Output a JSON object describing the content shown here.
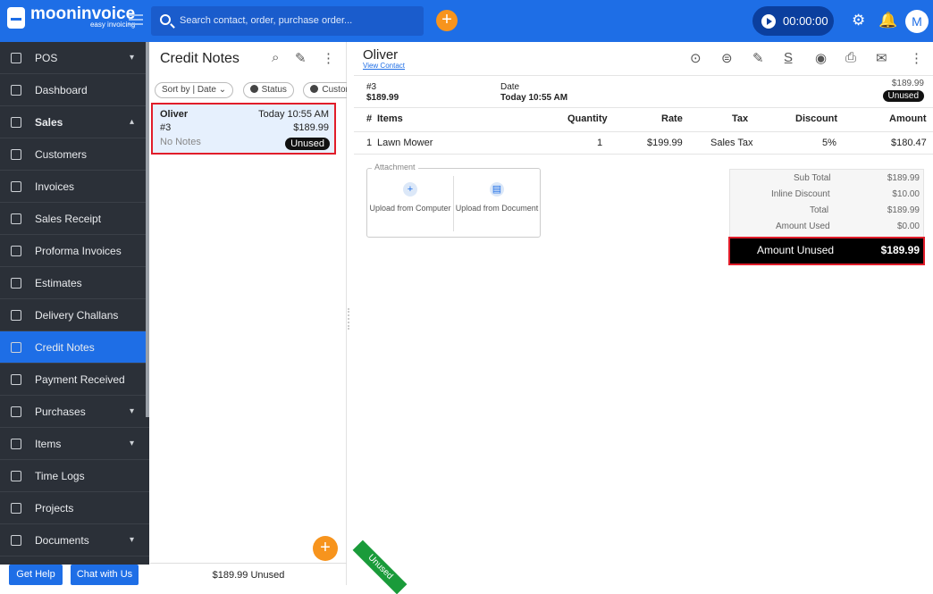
{
  "brand": {
    "name": "mooninvoice",
    "tagline": "easy invoicing"
  },
  "header": {
    "search_placeholder": "Search contact, order, purchase order...",
    "timer": "00:00:00",
    "avatar": "M"
  },
  "sidebar": {
    "items": [
      {
        "label": "POS",
        "icon": "pos-icon",
        "chevron": "▾"
      },
      {
        "label": "Dashboard",
        "icon": "home-icon"
      },
      {
        "label": "Sales",
        "icon": "dollar-icon",
        "chevron": "▴"
      },
      {
        "label": "Customers",
        "icon": "contacts-icon"
      },
      {
        "label": "Invoices",
        "icon": "invoice-icon"
      },
      {
        "label": "Sales Receipt",
        "icon": "receipt-icon"
      },
      {
        "label": "Proforma Invoices",
        "icon": "proforma-icon"
      },
      {
        "label": "Estimates",
        "icon": "estimates-icon"
      },
      {
        "label": "Delivery Challans",
        "icon": "delivery-icon"
      },
      {
        "label": "Credit Notes",
        "icon": "credit-notes-icon"
      },
      {
        "label": "Payment Received",
        "icon": "payment-icon"
      },
      {
        "label": "Purchases",
        "icon": "purchases-icon",
        "chevron": "▾"
      },
      {
        "label": "Items",
        "icon": "items-icon",
        "chevron": "▾"
      },
      {
        "label": "Time Logs",
        "icon": "clock-icon"
      },
      {
        "label": "Projects",
        "icon": "folder-icon"
      },
      {
        "label": "Documents",
        "icon": "documents-icon",
        "chevron": "▾"
      }
    ],
    "help": "Get Help",
    "chat": "Chat with Us"
  },
  "list": {
    "title": "Credit Notes",
    "chips": [
      "Sort by | Date ⌄",
      "Status",
      "Custor"
    ],
    "card": {
      "name": "Oliver",
      "date": "Today 10:55 AM",
      "number": "#3",
      "amount": "$189.99",
      "notes": "No Notes",
      "status": "Unused"
    },
    "footer": "$189.99 Unused"
  },
  "detail": {
    "contact": "Oliver",
    "view_contact": "View Contact",
    "number": "#3",
    "amount": "$189.99",
    "date_label": "Date",
    "date_value": "Today 10:55 AM",
    "top_amount": "$189.99",
    "status": "Unused",
    "columns": [
      "#",
      "Items",
      "Quantity",
      "Rate",
      "Tax",
      "Discount",
      "Amount"
    ],
    "row": {
      "no": "1",
      "item": "Lawn Mower",
      "qty": "1",
      "rate": "$199.99",
      "tax": "Sales Tax",
      "discount": "5%",
      "amount": "$180.47"
    },
    "attachment": {
      "legend": "Attachment",
      "computer": "Upload from Computer",
      "document": "Upload from Document"
    },
    "totals": [
      {
        "label": "Sub Total",
        "value": "$189.99"
      },
      {
        "label": "Inline Discount",
        "value": "$10.00"
      },
      {
        "label": "Total",
        "value": "$189.99"
      },
      {
        "label": "Amount Used",
        "value": "$0.00"
      }
    ],
    "amount_unused_label": "Amount Unused",
    "amount_unused_value": "$189.99",
    "ribbon": "Unused"
  }
}
